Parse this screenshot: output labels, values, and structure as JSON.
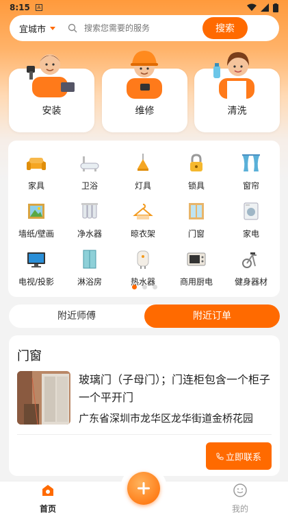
{
  "status": {
    "time": "8:15"
  },
  "search": {
    "city": "宜城市",
    "placeholder": "搜索您需要的服务",
    "button": "搜索"
  },
  "services": [
    {
      "label": "安装",
      "icon": "installer-avatar-icon"
    },
    {
      "label": "维修",
      "icon": "repairman-avatar-icon"
    },
    {
      "label": "清洗",
      "icon": "cleaner-avatar-icon"
    }
  ],
  "categories": [
    {
      "label": "家具",
      "icon": "sofa-icon"
    },
    {
      "label": "卫浴",
      "icon": "bathtub-icon"
    },
    {
      "label": "灯具",
      "icon": "lamp-icon"
    },
    {
      "label": "锁具",
      "icon": "lock-icon"
    },
    {
      "label": "窗帘",
      "icon": "curtain-icon"
    },
    {
      "label": "墙纸/壁画",
      "icon": "wall-painting-icon"
    },
    {
      "label": "净水器",
      "icon": "water-purifier-icon"
    },
    {
      "label": "晾衣架",
      "icon": "hanger-icon"
    },
    {
      "label": "门窗",
      "icon": "window-icon"
    },
    {
      "label": "家电",
      "icon": "washing-machine-icon"
    },
    {
      "label": "电视/投影",
      "icon": "tv-icon"
    },
    {
      "label": "淋浴房",
      "icon": "shower-room-icon"
    },
    {
      "label": "热水器",
      "icon": "water-heater-icon"
    },
    {
      "label": "商用厨电",
      "icon": "oven-icon"
    },
    {
      "label": "健身器材",
      "icon": "exercise-bike-icon"
    }
  ],
  "tabs": {
    "nearby_masters": "附近师傅",
    "nearby_orders": "附近订单"
  },
  "order": {
    "title": "门窗",
    "description": "玻璃门（子母门）；门连柜包含一个柜子一个平开门",
    "address": "广东省深圳市龙华区龙华街道金桥花园",
    "contact_button": "立即联系"
  },
  "nav": {
    "home": "首页",
    "mine": "我的"
  },
  "colors": {
    "accent": "#ff6a00"
  }
}
